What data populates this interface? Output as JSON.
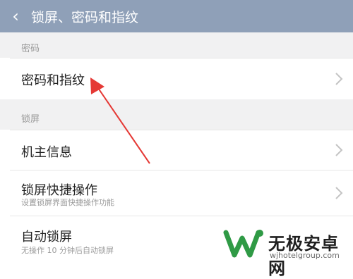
{
  "header": {
    "back_icon": "chevron-left-icon",
    "title": "锁屏、密码和指纹"
  },
  "sections": [
    {
      "label": "密码",
      "items": [
        {
          "title": "密码和指纹"
        }
      ]
    },
    {
      "label": "锁屏",
      "items": [
        {
          "title": "机主信息"
        },
        {
          "title": "锁屏快捷操作",
          "subtitle": "设置锁屏界面快捷操作功能"
        },
        {
          "title": "自动锁屏",
          "subtitle": "无操作 10 分钟后自动锁屏"
        }
      ]
    }
  ],
  "watermark": {
    "title": "无极安卓网",
    "url": "wjhotelgroup.com"
  },
  "colors": {
    "header_bg": "#8fa0b8",
    "section_bg": "#f1f1f2",
    "arrow": "#e53935",
    "logo_green": "#2f9a45"
  }
}
